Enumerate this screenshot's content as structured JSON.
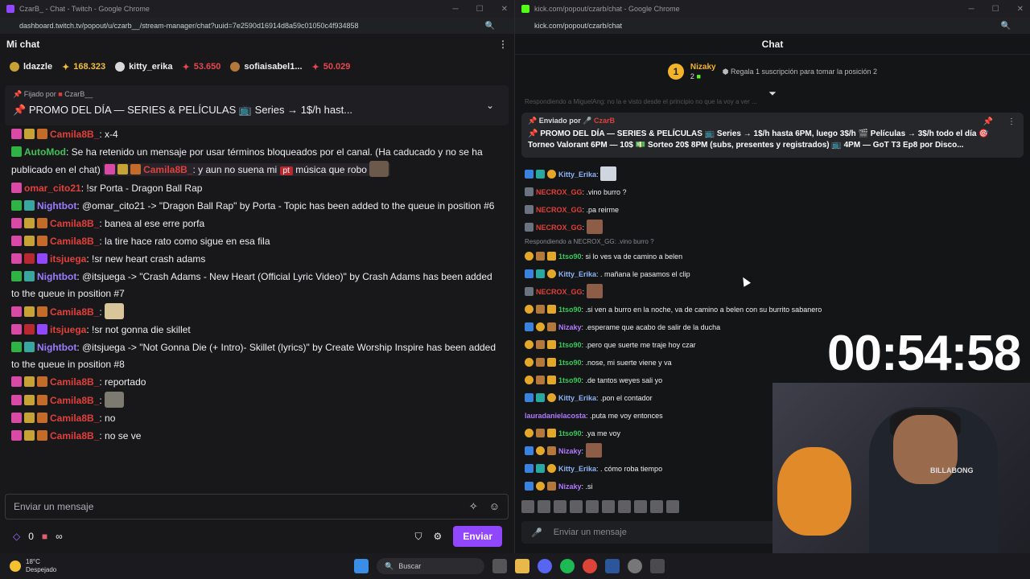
{
  "twitch_window": {
    "title": "CzarB_ - Chat - Twitch - Google Chrome",
    "url": "dashboard.twitch.tv/popout/u/czarb__/stream-manager/chat?uuid=7e2590d16914d8a59c01050c4f934858",
    "header": "Mi chat",
    "leaderboard": [
      {
        "name": "ldazzle",
        "value": "",
        "value_color": ""
      },
      {
        "name": "",
        "value": "168.323",
        "value_color": "gold"
      },
      {
        "name": "kitty_erika",
        "value": "",
        "value_color": ""
      },
      {
        "name": "",
        "value": "53.650",
        "value_color": "red"
      },
      {
        "name": "sofiaisabel1...",
        "value": "",
        "value_color": ""
      },
      {
        "name": "",
        "value": "50.029",
        "value_color": "red"
      }
    ],
    "pinned": {
      "by_label": "Fijado por",
      "by_user": "CzarB__",
      "message": "PROMO DEL DÍA — SERIES & PELÍCULAS 📺 Series → 1$/h hast..."
    },
    "chat": [
      {
        "nick": "Camila8B_",
        "text": ": x-4"
      },
      {
        "nick": "AutoMod",
        "text": ": Se ha retenido un mensaje por usar términos bloqueados por el canal. (Ha caducado y no se ha publicado en el chat)"
      },
      {
        "nick": "Camila8B_",
        "text": ": y aun no suena mi",
        "tag": "pt",
        "text2": "música que robo"
      },
      {
        "nick": "omar_cito21",
        "text": ": !sr Porta - Dragon Ball Rap"
      },
      {
        "nick": "Nightbot",
        "text": ": @omar_cito21 -> \"Dragon Ball Rap\" by Porta - Topic has been added to the queue in position #6"
      },
      {
        "nick": "Camila8B_",
        "text": ": banea al ese erre porfa"
      },
      {
        "nick": "Camila8B_",
        "text": ": la tire hace rato como sigue en esa fila"
      },
      {
        "nick": "itsjuega",
        "text": ": !sr new heart crash adams"
      },
      {
        "nick": "Nightbot",
        "text": ": @itsjuega -> \"Crash Adams - New Heart (Official Lyric Video)\" by Crash Adams has been added to the queue in position #7"
      },
      {
        "nick": "Camila8B_",
        "text": ":"
      },
      {
        "nick": "itsjuega",
        "text": ": !sr not gonna die skillet"
      },
      {
        "nick": "Nightbot",
        "text": ": @itsjuega -> \"Not Gonna Die (+ Intro)- Skillet (lyrics)\" by Create Worship Inspire has been added to the queue in position #8"
      },
      {
        "nick": "Camila8B_",
        "text": ": reportado"
      },
      {
        "nick": "Camila8B_",
        "text": ":"
      },
      {
        "nick": "Camila8B_",
        "text": ": no"
      },
      {
        "nick": "Camila8B_",
        "text": ": no se ve"
      }
    ],
    "input_placeholder": "Enviar un mensaje",
    "points": "0",
    "infinity": "∞",
    "send_label": "Enviar"
  },
  "kick_window": {
    "title": "kick.com/popout/czarb/chat - Google Chrome",
    "url": "kick.com/popout/czarb/chat",
    "header": "Chat",
    "top_gifter": {
      "rank": "1",
      "name": "Nizaky",
      "count": "2"
    },
    "gift_prompt": "Regala 1 suscripción para tomar la posición 2",
    "replying_fragment": "Respondiendo a MiguelAng: no la e visto desde el principio no que la voy a ver ...",
    "pinned": {
      "by_label": "Enviado por",
      "by_user": "CzarB",
      "message": "📌 PROMO DEL DÍA — SERIES & PELÍCULAS 📺 Series → 1$/h hasta 6PM, luego 3$/h 🎬 Películas → 3$/h todo el día 🎯 Torneo Valorant 6PM — 10$ 💵 Sorteo 20$ 8PM (subs, presentes y registrados) 📺 4PM — GoT T3 Ep8 por Disco..."
    },
    "chat": [
      {
        "nick": "Kitty_Erika",
        "text": ":"
      },
      {
        "nick": "NECROX_GG",
        "text": ": .vino burro ?"
      },
      {
        "nick": "NECROX_GG",
        "text": ": .pa reirme"
      },
      {
        "nick": "NECROX_GG",
        "text": ":"
      },
      {
        "reply": "Respondiendo a NECROX_GG: .vino burro ?"
      },
      {
        "nick": "1tso90",
        "text": ": si lo ves va de camino a belen"
      },
      {
        "nick": "Kitty_Erika",
        "text": ": . mañana le pasamos el clip"
      },
      {
        "nick": "NECROX_GG",
        "text": ":"
      },
      {
        "nick": "1tso90",
        "text": ": .si ven a burro en la noche, va de camino a belen con su burrito sabanero"
      },
      {
        "nick": "Nizaky",
        "text": ": .esperame que acabo de salir de la ducha"
      },
      {
        "nick": "1tso90",
        "text": ": .pero que suerte me traje hoy czar"
      },
      {
        "nick": "1tso90",
        "text": ": .nose, mi suerte viene y va"
      },
      {
        "nick": "1tso90",
        "text": ": .de tantos weyes sali yo"
      },
      {
        "nick": "Kitty_Erika",
        "text": ": .pon el contador"
      },
      {
        "nick": "lauradanielacosta",
        "text": ": .puta me voy entonces"
      },
      {
        "nick": "1tso90",
        "text": ": .ya me voy"
      },
      {
        "nick": "Nizaky",
        "text": ":"
      },
      {
        "nick": "Kitty_Erika",
        "text": ": . cómo roba tiempo"
      },
      {
        "nick": "Nizaky",
        "text": ": .si"
      }
    ],
    "input_placeholder": "Enviar un mensaje"
  },
  "overlay": {
    "timer": "00:54:58",
    "shirt_text": "BILLABONG"
  },
  "taskbar": {
    "temperature": "18°C",
    "weather": "Despejado",
    "search": "Buscar"
  }
}
